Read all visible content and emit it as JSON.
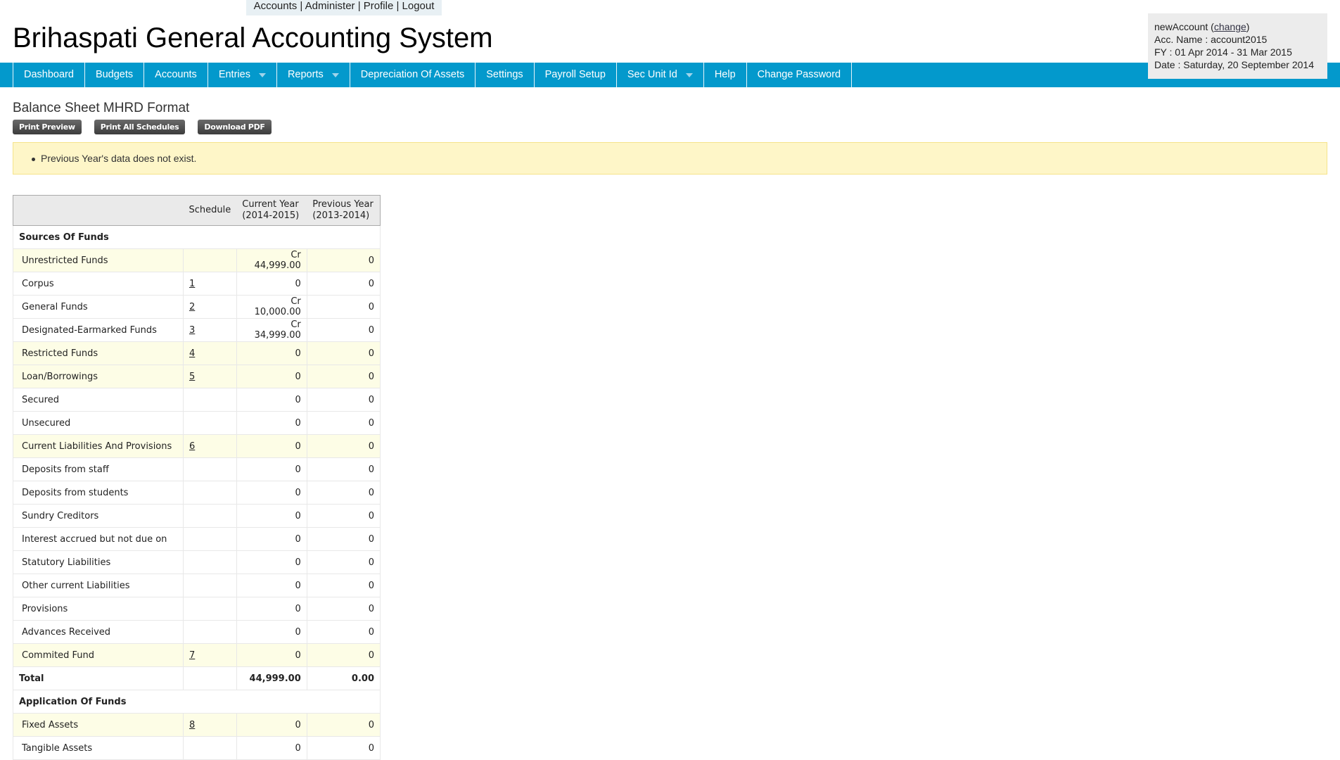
{
  "top_links": [
    "Accounts",
    "Administer",
    "Profile",
    "Logout"
  ],
  "app_title": "Brihaspati General Accounting System",
  "nav": [
    {
      "label": "Dashboard"
    },
    {
      "label": "Budgets"
    },
    {
      "label": "Accounts"
    },
    {
      "label": "Entries",
      "dropdown": true
    },
    {
      "label": "Reports",
      "dropdown": true
    },
    {
      "label": "Depreciation Of Assets"
    },
    {
      "label": "Settings"
    },
    {
      "label": "Payroll Setup"
    },
    {
      "label": "Sec Unit Id",
      "dropdown": true
    },
    {
      "label": "Help"
    },
    {
      "label": "Change Password"
    }
  ],
  "info": {
    "account": "newAccount",
    "change": "change",
    "acc_name": "Acc. Name : account2015",
    "fy": "FY : 01 Apr 2014 - 31 Mar 2015",
    "date": "Date : Saturday, 20 September 2014"
  },
  "page_title": "Balance Sheet MHRD Format",
  "buttons": {
    "print_preview": "Print Preview",
    "print_all": "Print All Schedules",
    "download_pdf": "Download PDF"
  },
  "notice": "Previous Year's data does not exist.",
  "table": {
    "headers": {
      "name": "",
      "schedule": "Schedule",
      "current": "Current Year",
      "current_period": "(2014-2015)",
      "previous": "Previous Year",
      "previous_period": "(2013-2014)"
    },
    "rows": [
      {
        "type": "section",
        "name": "Sources Of Funds"
      },
      {
        "type": "item",
        "hl": true,
        "name": "Unrestricted Funds",
        "schedule": "",
        "current": "Cr 44,999.00",
        "previous": "0"
      },
      {
        "type": "item",
        "name": "Corpus",
        "schedule": "1",
        "current": "0",
        "previous": "0"
      },
      {
        "type": "item",
        "name": "General Funds",
        "schedule": "2",
        "current": "Cr 10,000.00",
        "previous": "0"
      },
      {
        "type": "item",
        "name": "Designated-Earmarked Funds",
        "schedule": "3",
        "current": "Cr 34,999.00",
        "previous": "0"
      },
      {
        "type": "item",
        "hl": true,
        "name": "Restricted Funds",
        "schedule": "4",
        "current": "0",
        "previous": "0"
      },
      {
        "type": "item",
        "hl": true,
        "name": "Loan/Borrowings",
        "schedule": "5",
        "current": "0",
        "previous": "0"
      },
      {
        "type": "item",
        "name": "Secured",
        "schedule": "",
        "current": "0",
        "previous": "0"
      },
      {
        "type": "item",
        "name": "Unsecured",
        "schedule": "",
        "current": "0",
        "previous": "0"
      },
      {
        "type": "item",
        "hl": true,
        "name": "Current Liabilities And Provisions",
        "schedule": "6",
        "current": "0",
        "previous": "0"
      },
      {
        "type": "item",
        "name": "Deposits from staff",
        "schedule": "",
        "current": "0",
        "previous": "0"
      },
      {
        "type": "item",
        "name": "Deposits from students",
        "schedule": "",
        "current": "0",
        "previous": "0"
      },
      {
        "type": "item",
        "name": "Sundry Creditors",
        "schedule": "",
        "current": "0",
        "previous": "0"
      },
      {
        "type": "item",
        "name": "Interest accrued but not due on",
        "schedule": "",
        "current": "0",
        "previous": "0"
      },
      {
        "type": "item",
        "name": "Statutory Liabilities",
        "schedule": "",
        "current": "0",
        "previous": "0"
      },
      {
        "type": "item",
        "name": "Other current Liabilities",
        "schedule": "",
        "current": "0",
        "previous": "0"
      },
      {
        "type": "item",
        "name": "Provisions",
        "schedule": "",
        "current": "0",
        "previous": "0"
      },
      {
        "type": "item",
        "name": "Advances Received",
        "schedule": "",
        "current": "0",
        "previous": "0"
      },
      {
        "type": "item",
        "hl": true,
        "name": "Commited Fund",
        "schedule": "7",
        "current": "0",
        "previous": "0"
      },
      {
        "type": "total",
        "name": "Total",
        "schedule": "",
        "current": "44,999.00",
        "previous": "0.00"
      },
      {
        "type": "section",
        "name": "Application Of Funds"
      },
      {
        "type": "item",
        "hl": true,
        "name": "Fixed Assets",
        "schedule": "8",
        "current": "0",
        "previous": "0"
      },
      {
        "type": "item",
        "name": "Tangible Assets",
        "schedule": "",
        "current": "0",
        "previous": "0"
      }
    ]
  }
}
